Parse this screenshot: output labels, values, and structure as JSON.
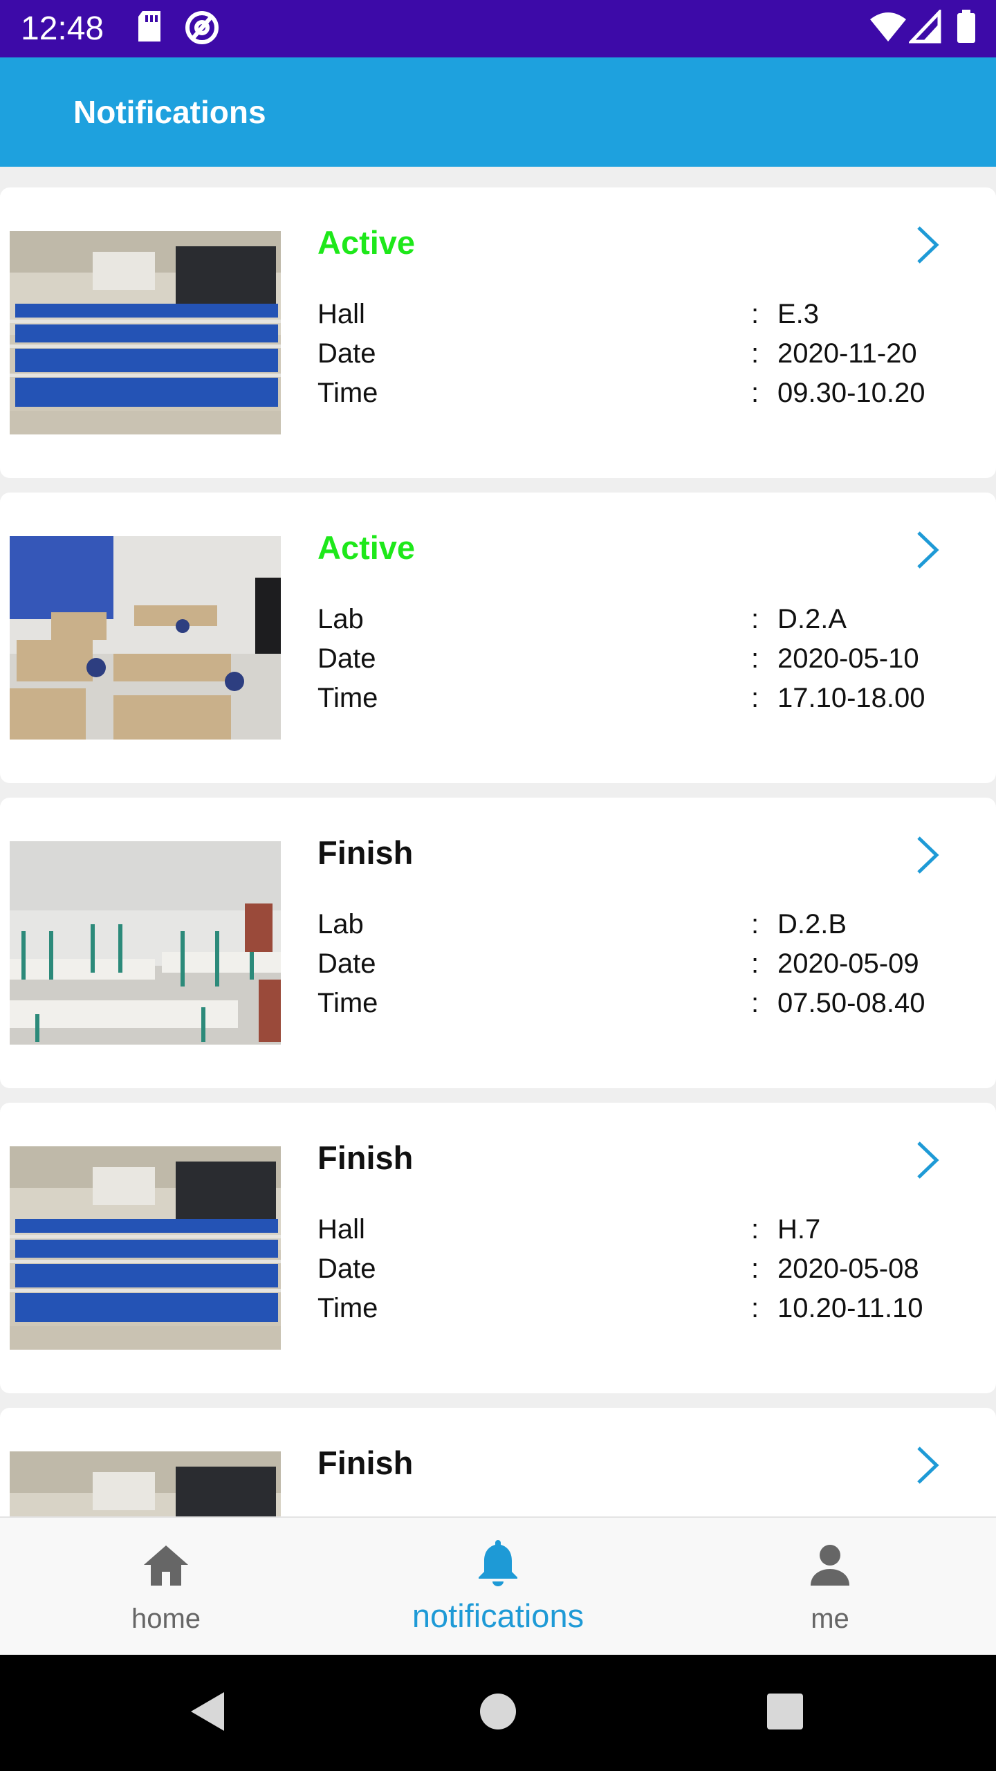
{
  "status_bar": {
    "time": "12:48",
    "icons": [
      "sd-card-icon",
      "at-sync-icon",
      "wifi-icon",
      "signal-icon",
      "battery-icon"
    ]
  },
  "app_bar": {
    "title": "Notifications"
  },
  "colors": {
    "status_bar": "#3d0aa8",
    "app_bar": "#1ea1de",
    "active_status": "#1ee81a",
    "accent": "#1e9ad6"
  },
  "cards": [
    {
      "status": "Active",
      "thumb": "hall",
      "fields": [
        {
          "label": "Hall",
          "value": "E.3"
        },
        {
          "label": "Date",
          "value": "2020-11-20"
        },
        {
          "label": "Time",
          "value": "09.30-10.20"
        }
      ]
    },
    {
      "status": "Active",
      "thumb": "lab",
      "fields": [
        {
          "label": "Lab",
          "value": "D.2.A"
        },
        {
          "label": "Date",
          "value": "2020-05-10"
        },
        {
          "label": "Time",
          "value": "17.10-18.00"
        }
      ]
    },
    {
      "status": "Finish",
      "thumb": "lab2",
      "fields": [
        {
          "label": "Lab",
          "value": "D.2.B"
        },
        {
          "label": "Date",
          "value": "2020-05-09"
        },
        {
          "label": "Time",
          "value": "07.50-08.40"
        }
      ]
    },
    {
      "status": "Finish",
      "thumb": "hall",
      "fields": [
        {
          "label": "Hall",
          "value": "H.7"
        },
        {
          "label": "Date",
          "value": "2020-05-08"
        },
        {
          "label": "Time",
          "value": "10.20-11.10"
        }
      ]
    },
    {
      "status": "Finish",
      "thumb": "hall",
      "fields": []
    }
  ],
  "colon": ":",
  "bottom_nav": [
    {
      "label": "home",
      "icon": "home-icon",
      "selected": false
    },
    {
      "label": "notifications",
      "icon": "bell-icon",
      "selected": true
    },
    {
      "label": "me",
      "icon": "person-icon",
      "selected": false
    }
  ],
  "system_nav": [
    "back-icon",
    "home-circle-icon",
    "recents-icon"
  ]
}
